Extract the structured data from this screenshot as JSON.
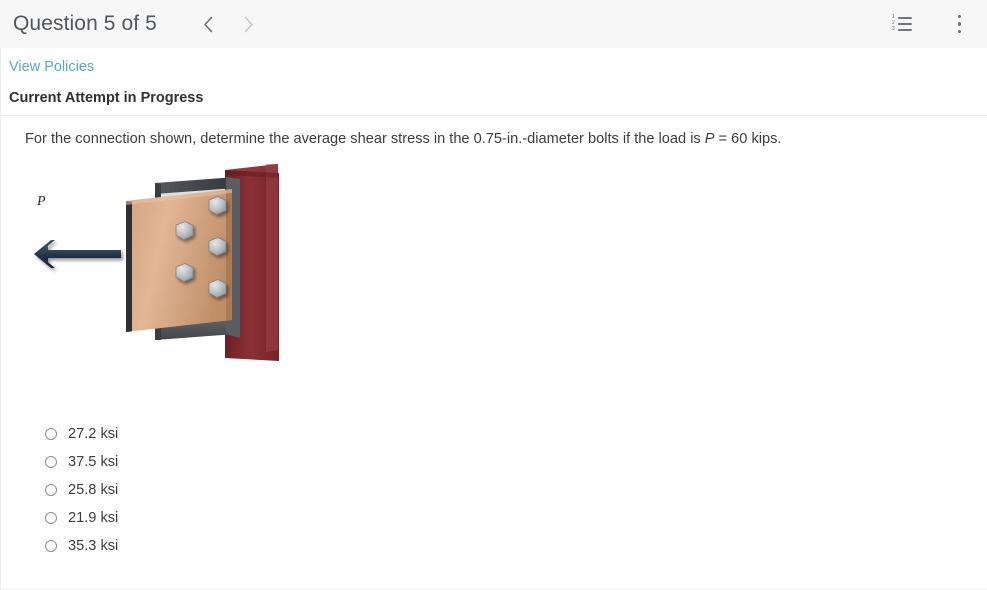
{
  "header": {
    "title": "Question 5 of 5",
    "prev_icon": "chevron-left-icon",
    "next_icon": "chevron-right-icon",
    "numbered_list_icon": "numbered-list-icon",
    "numbered_list_numbers": [
      "1",
      "2",
      "3"
    ],
    "overflow_menu_icon": "vertical-ellipsis-icon",
    "background_color": "#f7f7f8"
  },
  "body": {
    "policies_link": "View Policies",
    "policies_link_color": "#5aa7c9",
    "attempt_status": "Current Attempt in Progress"
  },
  "question": {
    "part1": "For the connection shown, determine the average shear stress in the 0.75-in.-diameter bolts if the load is ",
    "symbol": "P",
    "part2": " = 60 kips."
  },
  "figure": {
    "name": "bolted-connection-diagram",
    "load_label": "P",
    "wall_color": "#7d262b",
    "wall_color_light": "#9a3a40",
    "plate_color": "#d9a882",
    "plate_color_light": "#e5bb9a",
    "plate_color_dark": "#b98660",
    "steel_color": "#5b5f63",
    "steel_color_dark": "#3c4044",
    "bolt_color": "#c3c6c9",
    "bolt_color_dark": "#8d9094",
    "arrow_color": "#2c4055",
    "bolt_count": 5
  },
  "options": [
    {
      "label": "27.2 ksi",
      "selected": false
    },
    {
      "label": "37.5 ksi",
      "selected": false
    },
    {
      "label": "25.8 ksi",
      "selected": false
    },
    {
      "label": "21.9 ksi",
      "selected": false
    },
    {
      "label": "35.3 ksi",
      "selected": false
    }
  ]
}
